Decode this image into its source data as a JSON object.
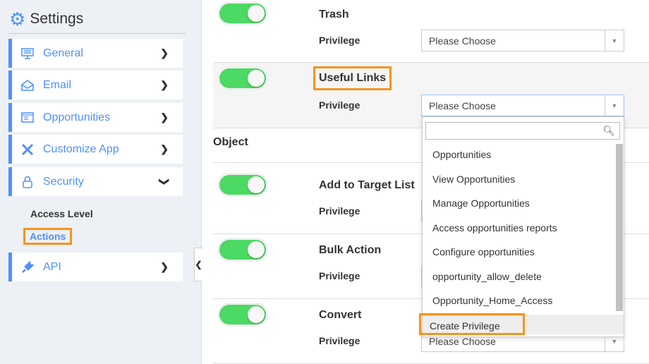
{
  "sidebar": {
    "title": "Settings",
    "items": [
      {
        "label": "General",
        "icon": "monitor-icon"
      },
      {
        "label": "Email",
        "icon": "envelope-open-icon"
      },
      {
        "label": "Opportunities",
        "icon": "window-icon"
      },
      {
        "label": "Customize App",
        "icon": "tools-icon"
      },
      {
        "label": "Security",
        "icon": "lock-icon",
        "expanded": true
      },
      {
        "label": "API",
        "icon": "plug-icon"
      }
    ],
    "sub_items": [
      "Access Level",
      "Actions"
    ],
    "active_sub": "Actions"
  },
  "main": {
    "rows": [
      {
        "name": "Trash",
        "privilege_label": "Privilege",
        "value": "Please Choose",
        "enabled": true
      },
      {
        "name": "Useful Links",
        "privilege_label": "Privilege",
        "value": "Please Choose",
        "enabled": true
      },
      {
        "name": "Add to Target List",
        "privilege_label": "Privilege",
        "enabled": true
      },
      {
        "name": "Bulk Action",
        "privilege_label": "Privilege",
        "enabled": true
      },
      {
        "name": "Convert",
        "privilege_label": "Privilege",
        "value": "Please Choose",
        "enabled": true
      }
    ],
    "section": "Object"
  },
  "dropdown": {
    "search_value": "",
    "options": [
      "Opportunities",
      "View Opportunities",
      "Manage Opportunities",
      "Access opportunities reports",
      "Configure opportunities",
      "opportunity_allow_delete",
      "Opportunity_Home_Access"
    ],
    "create": "Create Privilege"
  },
  "colors": {
    "accent": "#4d90fe",
    "toggle_on": "#4cd964",
    "highlight": "#f7941d"
  }
}
